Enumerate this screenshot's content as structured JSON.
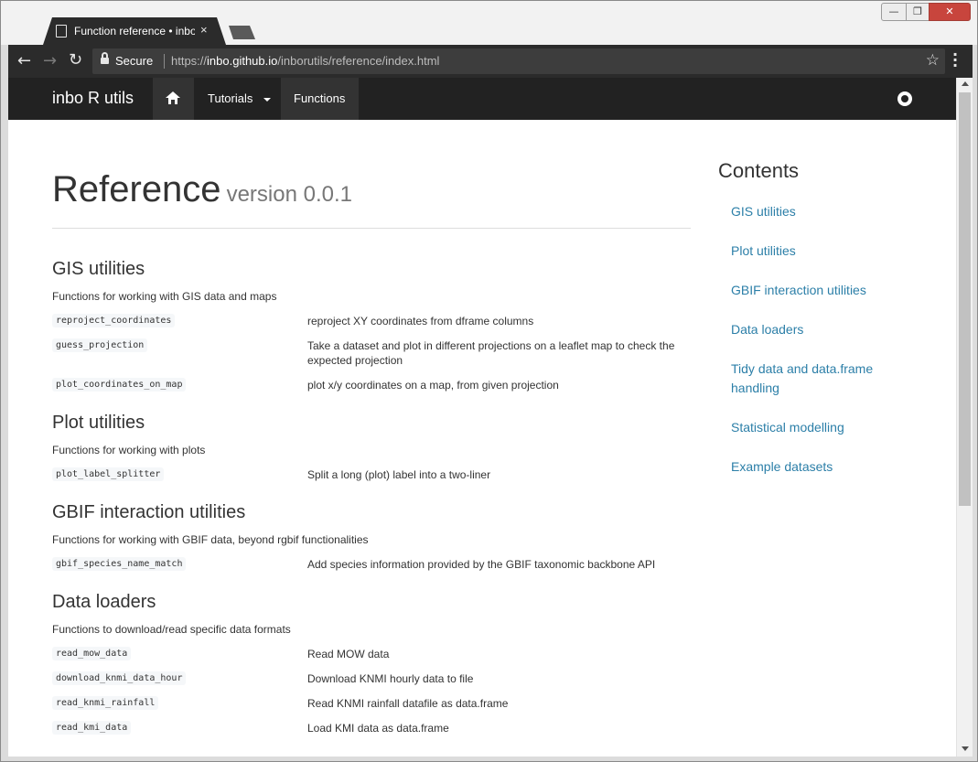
{
  "browser": {
    "tab_title": "Function reference • inbo",
    "tab_close": "×",
    "secure_label": "Secure",
    "url_scheme": "https://",
    "url_host": "inbo.github.io",
    "url_path": "/inborutils/reference/index.html",
    "window_buttons": {
      "minimize": "—",
      "maximize": "❐",
      "close": "✕"
    }
  },
  "navbar": {
    "brand": "inbo R utils",
    "tutorials_label": "Tutorials",
    "functions_label": "Functions"
  },
  "page": {
    "title": "Reference",
    "version": "version 0.0.1"
  },
  "sections": [
    {
      "title": "GIS utilities",
      "description": "Functions for working with GIS data and maps",
      "functions": [
        {
          "name": "reproject_coordinates",
          "desc": "reproject XY coordinates from dframe columns"
        },
        {
          "name": "guess_projection",
          "desc": "Take a dataset and plot in different projections on a leaflet map to check the expected projection"
        },
        {
          "name": "plot_coordinates_on_map",
          "desc": "plot x/y coordinates on a map, from given projection"
        }
      ]
    },
    {
      "title": "Plot utilities",
      "description": "Functions for working with plots",
      "functions": [
        {
          "name": "plot_label_splitter",
          "desc": "Split a long (plot) label into a two-liner"
        }
      ]
    },
    {
      "title": "GBIF interaction utilities",
      "description": "Functions for working with GBIF data, beyond rgbif functionalities",
      "functions": [
        {
          "name": "gbif_species_name_match",
          "desc": "Add species information provided by the GBIF taxonomic backbone API"
        }
      ]
    },
    {
      "title": "Data loaders",
      "description": "Functions to download/read specific data formats",
      "functions": [
        {
          "name": "read_mow_data",
          "desc": "Read MOW data"
        },
        {
          "name": "download_knmi_data_hour",
          "desc": "Download KNMI hourly data to file"
        },
        {
          "name": "read_knmi_rainfall",
          "desc": "Read KNMI rainfall datafile as data.frame"
        },
        {
          "name": "read_kmi_data",
          "desc": "Load KMI data as data.frame"
        }
      ]
    }
  ],
  "toc": {
    "title": "Contents",
    "links": [
      "GIS utilities",
      "Plot utilities",
      "GBIF interaction utilities",
      "Data loaders",
      "Tidy data and data.frame handling",
      "Statistical modelling",
      "Example datasets"
    ]
  },
  "colors": {
    "navbar": "#222222",
    "link": "#2c7fa8",
    "code_bg": "#f5f7f9"
  },
  "icons": [
    "tab-page-icon",
    "back-icon",
    "forward-icon",
    "reload-icon",
    "lock-icon",
    "star-icon",
    "menu-icon",
    "home-icon",
    "github-icon"
  ]
}
